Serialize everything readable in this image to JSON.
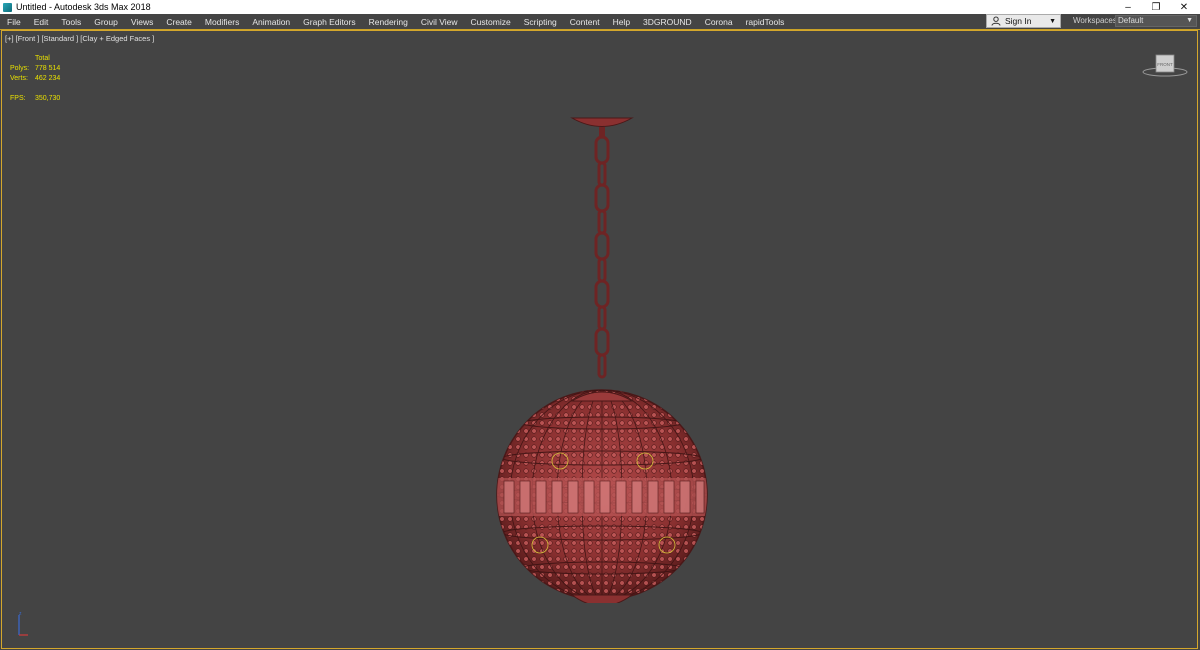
{
  "titlebar": {
    "title": "Untitled - Autodesk 3ds Max 2018",
    "minimize": "–",
    "restore": "❐",
    "close": "✕"
  },
  "menubar": {
    "items": [
      "File",
      "Edit",
      "Tools",
      "Group",
      "Views",
      "Create",
      "Modifiers",
      "Animation",
      "Graph Editors",
      "Rendering",
      "Civil View",
      "Customize",
      "Scripting",
      "Content",
      "Help",
      "3DGROUND",
      "Corona",
      "rapidTools"
    ]
  },
  "signin": {
    "label": "Sign In"
  },
  "workspaces": {
    "label": "Workspaces:",
    "value": "Default"
  },
  "viewport": {
    "label": "[+] [Front ] [Standard ] [Clay + Edged Faces ]",
    "stats": {
      "header": "Total",
      "polys_label": "Polys:",
      "polys_value": "778 514",
      "verts_label": "Verts:",
      "verts_value": "462 234",
      "fps_label": "FPS:",
      "fps_value": "350,730"
    },
    "viewcube_label": "FRONT"
  },
  "colors": {
    "model": "#9a3a3a",
    "model_dark": "#5a1c1c",
    "viewport_border": "#d4a72c",
    "stats_text": "#e8e000"
  }
}
